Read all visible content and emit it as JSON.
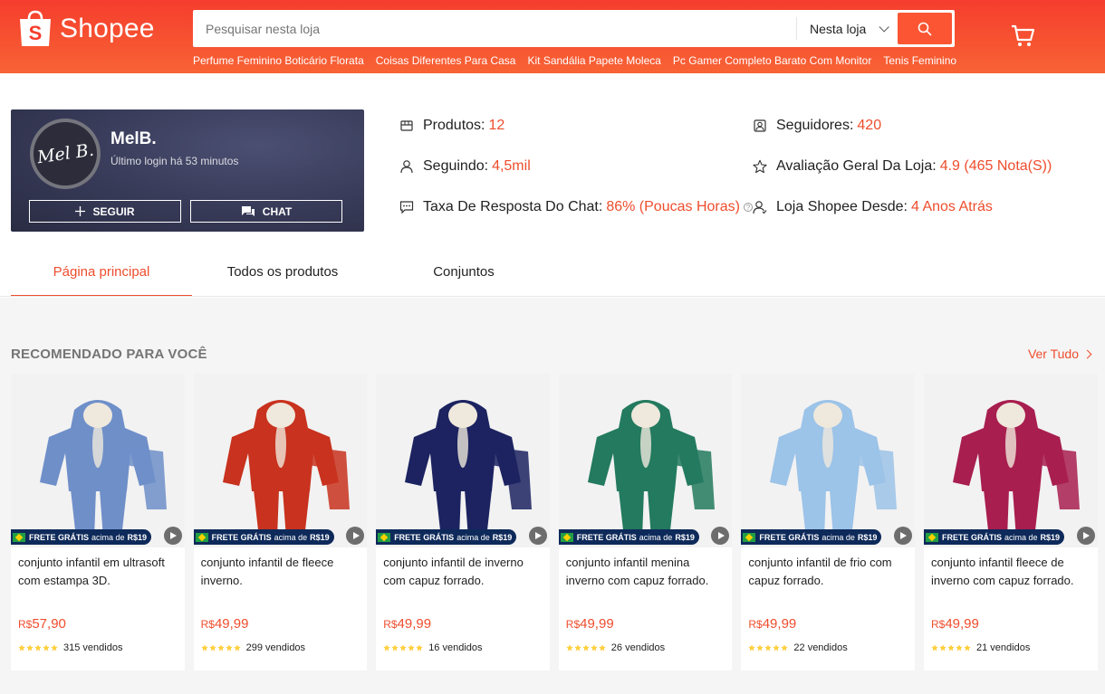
{
  "header": {
    "logo_text": "Shopee",
    "search_placeholder": "Pesquisar nesta loja",
    "search_scope": "Nesta loja",
    "hints": [
      "Perfume Feminino Boticário Florata",
      "Coisas Diferentes Para Casa",
      "Kit Sandália Papete Moleca",
      "Pc Gamer Completo Barato Com Monitor",
      "Tenis Feminino"
    ],
    "brand_color": "#ee4d2d"
  },
  "shop": {
    "avatar_text": "Mel B.",
    "name": "MelB.",
    "last_login": "Último login há 53 minutos",
    "follow_label": "SEGUIR",
    "chat_label": "CHAT",
    "stats": {
      "products_label": "Produtos:",
      "products_value": "12",
      "following_label": "Seguindo:",
      "following_value": "4,5mil",
      "response_label": "Taxa De Resposta Do Chat:",
      "response_value": "86% (Poucas Horas)",
      "followers_label": "Seguidores:",
      "followers_value": "420",
      "rating_label": "Avaliação Geral Da Loja:",
      "rating_value": "4.9 (465 Nota(S))",
      "since_label": "Loja Shopee Desde:",
      "since_value": "4 Anos Atrás"
    }
  },
  "tabs": [
    "Página principal",
    "Todos os produtos",
    "Conjuntos"
  ],
  "recommended": {
    "title": "RECOMENDADO PARA VOCÊ",
    "see_all": "Ver Tudo",
    "promo_main": "FRETE GRÁTIS",
    "promo_small": "acima de",
    "promo_value": "R$19",
    "currency": "R$",
    "sold_suffix": "vendidos",
    "products": [
      {
        "name": "conjunto infantil em ultrasoft com estampa 3D.",
        "price": "57,90",
        "sold": "315",
        "rating": 4.5,
        "color": "#6f8fc9"
      },
      {
        "name": "conjunto infantil de fleece inverno.",
        "price": "49,99",
        "sold": "299",
        "rating": 4.5,
        "color": "#c8321e"
      },
      {
        "name": "conjunto infantil de inverno com capuz forrado.",
        "price": "49,99",
        "sold": "16",
        "rating": 5,
        "color": "#1c2360"
      },
      {
        "name": "conjunto infantil menina inverno com capuz forrado.",
        "price": "49,99",
        "sold": "26",
        "rating": 4.5,
        "color": "#237a5e"
      },
      {
        "name": "conjunto infantil de frio com capuz forrado.",
        "price": "49,99",
        "sold": "22",
        "rating": 4.5,
        "color": "#9cc3e8"
      },
      {
        "name": "conjunto infantil fleece de inverno com capuz forrado.",
        "price": "49,99",
        "sold": "21",
        "rating": 5,
        "color": "#a81e4f"
      }
    ]
  }
}
